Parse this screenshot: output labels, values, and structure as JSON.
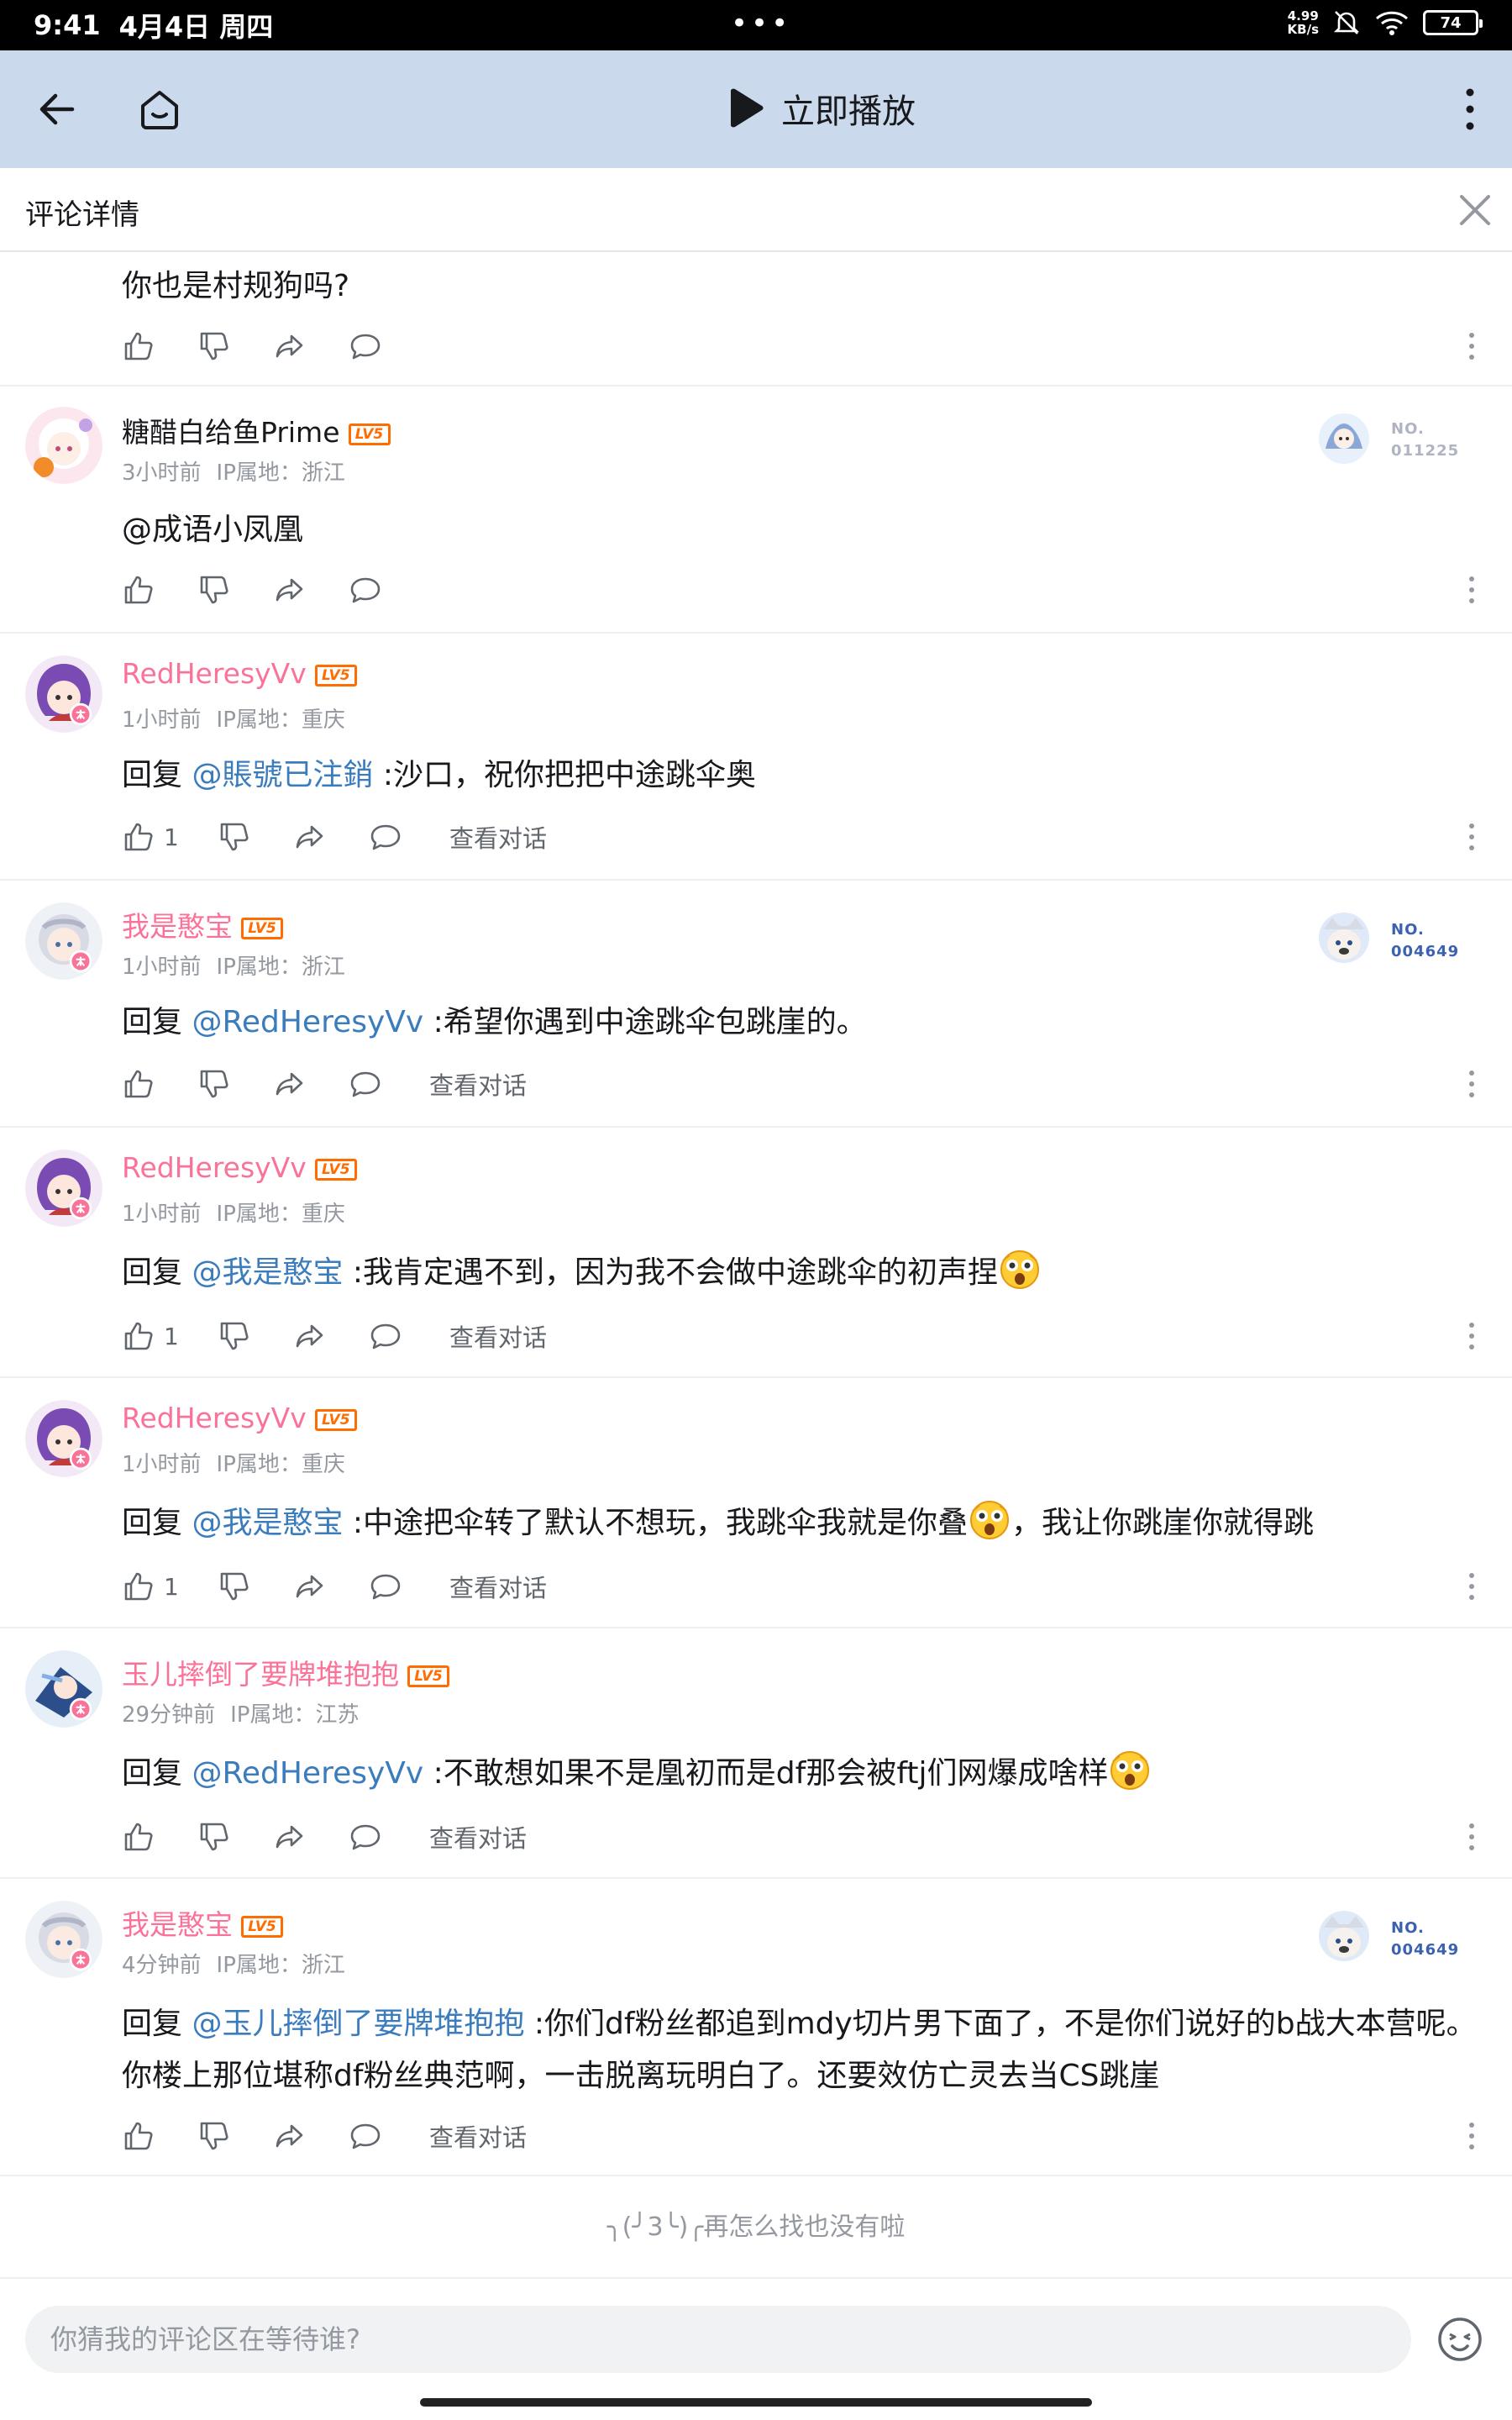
{
  "status_bar": {
    "time": "9:41",
    "date": "4月4日 周四",
    "dots": "•••",
    "net_speed_value": "4.99",
    "net_speed_unit": "KB/s",
    "battery": "74"
  },
  "nav": {
    "play_label": "立即播放"
  },
  "panel": {
    "title": "评论详情"
  },
  "colors": {
    "accent_pink": "#fb7299",
    "mention_blue": "#3b7cbd",
    "nav_bg": "#cbd9ed",
    "level_orange": "#ff6c00"
  },
  "comments": [
    {
      "text": "你也是村规狗吗?"
    },
    {
      "username": "糖醋白给鱼Prime",
      "level": "LV5",
      "time": "3小时前",
      "ip": "IP属地：浙江",
      "text": "@成语小凤凰",
      "badge_no": "NO.",
      "badge_num": "011225"
    },
    {
      "username": "RedHeresyVv",
      "level": "LV5",
      "time": "1小时前",
      "ip": "IP属地：重庆",
      "reply_prefix": "回复 ",
      "mention": "@賬號已注銷",
      "text": " :沙口，祝你把把中途跳伞奥",
      "likes": "1",
      "view_convo": "查看对话"
    },
    {
      "username": "我是憨宝",
      "level": "LV5",
      "time": "1小时前",
      "ip": "IP属地：浙江",
      "reply_prefix": "回复 ",
      "mention": "@RedHeresyVv",
      "text": " :希望你遇到中途跳伞包跳崖的。",
      "view_convo": "查看对话",
      "badge_no": "NO.",
      "badge_num": "004649"
    },
    {
      "username": "RedHeresyVv",
      "level": "LV5",
      "time": "1小时前",
      "ip": "IP属地：重庆",
      "reply_prefix": "回复 ",
      "mention": "@我是憨宝",
      "text": " :我肯定遇不到，因为我不会做中途跳伞的初声捏",
      "likes": "1",
      "view_convo": "查看对话"
    },
    {
      "username": "RedHeresyVv",
      "level": "LV5",
      "time": "1小时前",
      "ip": "IP属地：重庆",
      "reply_prefix": "回复 ",
      "mention": "@我是憨宝",
      "text": " :中途把伞转了默认不想玩，我跳伞我就是你叠",
      "text_after": "，我让你跳崖你就得跳",
      "likes": "1",
      "view_convo": "查看对话"
    },
    {
      "username": "玉儿摔倒了要牌堆抱抱",
      "level": "LV5",
      "time": "29分钟前",
      "ip": "IP属地：江苏",
      "reply_prefix": "回复 ",
      "mention": "@RedHeresyVv",
      "text": " :不敢想如果不是凰初而是df那会被ftj们网爆成啥样",
      "view_convo": "查看对话"
    },
    {
      "username": "我是憨宝",
      "level": "LV5",
      "time": "4分钟前",
      "ip": "IP属地：浙江",
      "reply_prefix": "回复 ",
      "mention": "@玉儿摔倒了要牌堆抱抱",
      "text": " :你们df粉丝都追到mdy切片男下面了，不是你们说好的b战大本营呢。你楼上那位堪称df粉丝典范啊，一击脱离玩明白了。还要效仿亡灵去当CS跳崖",
      "view_convo": "查看对话",
      "badge_no": "NO.",
      "badge_num": "004649"
    }
  ],
  "footer": {
    "end_note": "╮(╯3╰)╭再怎么找也没有啦",
    "input_placeholder": "你猜我的评论区在等待谁?"
  }
}
